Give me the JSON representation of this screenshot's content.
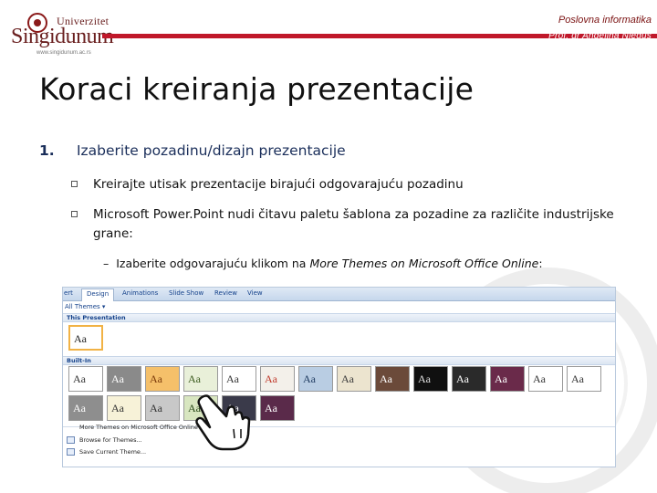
{
  "header": {
    "logo": {
      "university_label": "Univerzitet",
      "name": "Singidunum",
      "url": "www.singidunum.ac.rs",
      "brand_color": "#6a2020"
    },
    "course": "Poslovna informatika",
    "author": "Prof. dr Angelina Njeguš",
    "accent_color": "#c0182a"
  },
  "slide": {
    "title": "Koraci kreiranja prezentacije",
    "step": {
      "number": "1.",
      "text": "Izaberite pozadinu/dizajn prezentacije"
    },
    "bullets": [
      "Kreirajte utisak prezentacije birajući odgovarajuću pozadinu",
      "Microsoft Power.Point nudi čitavu paletu šablona za pozadine za različite industrijske grane:"
    ],
    "sub_bullet": {
      "dash": "–",
      "prefix": "Izaberite odgovarajuću klikom na ",
      "italic": "More Themes on Microsoft Office Online",
      "suffix": ":"
    }
  },
  "screenshot": {
    "ribbon_tabs": [
      "ert",
      "Design",
      "Animations",
      "Slide Show",
      "Review",
      "View"
    ],
    "active_tab": "Design",
    "gallery_header": "All Themes ▾",
    "section_this": "This Presentation",
    "section_builtin": "Built-In",
    "current_theme": {
      "label": "Aa",
      "bg": "#ffffff",
      "fg": "#222222"
    },
    "themes_row1": [
      {
        "label": "Aa",
        "bg": "#ffffff",
        "fg": "#333333"
      },
      {
        "label": "Aa",
        "bg": "#8a8a8a",
        "fg": "#ffffff"
      },
      {
        "label": "Aa",
        "bg": "#f5c06a",
        "fg": "#7a3a0a"
      },
      {
        "label": "Aa",
        "bg": "#e9f0d9",
        "fg": "#3b5a1e"
      },
      {
        "label": "Aa",
        "bg": "#ffffff",
        "fg": "#333333"
      },
      {
        "label": "Aa",
        "bg": "#f3f0ea",
        "fg": "#c0392b"
      },
      {
        "label": "Aa",
        "bg": "#b9cde3",
        "fg": "#1e3a5f"
      },
      {
        "label": "Aa",
        "bg": "#ece4cf",
        "fg": "#3a3a3a"
      },
      {
        "label": "Aa",
        "bg": "#6b4a3a",
        "fg": "#ffffff"
      },
      {
        "label": "Aa",
        "bg": "#101010",
        "fg": "#e0e0e0"
      },
      {
        "label": "Aa",
        "bg": "#2a2a2a",
        "fg": "#ffffff"
      },
      {
        "label": "Aa",
        "bg": "#6a2a4a",
        "fg": "#ffffff"
      },
      {
        "label": "Aa",
        "bg": "#ffffff",
        "fg": "#333333"
      },
      {
        "label": "Aa",
        "bg": "#ffffff",
        "fg": "#333333"
      }
    ],
    "themes_row2": [
      {
        "label": "Aa",
        "bg": "#8e8e8e",
        "fg": "#ffffff"
      },
      {
        "label": "Aa",
        "bg": "#f7f2d8",
        "fg": "#333333"
      },
      {
        "label": "Aa",
        "bg": "#c8c8c8",
        "fg": "#333333"
      },
      {
        "label": "Aa",
        "bg": "#d8e6c0",
        "fg": "#2a4a1a"
      },
      {
        "label": "Aa",
        "bg": "#3a3a4a",
        "fg": "#ffffff"
      },
      {
        "label": "Aa",
        "bg": "#5a2a4a",
        "fg": "#ffffff"
      }
    ],
    "menu_items": [
      "More Themes on Microsoft Office Online",
      "Browse for Themes...",
      "Save Current Theme..."
    ]
  }
}
